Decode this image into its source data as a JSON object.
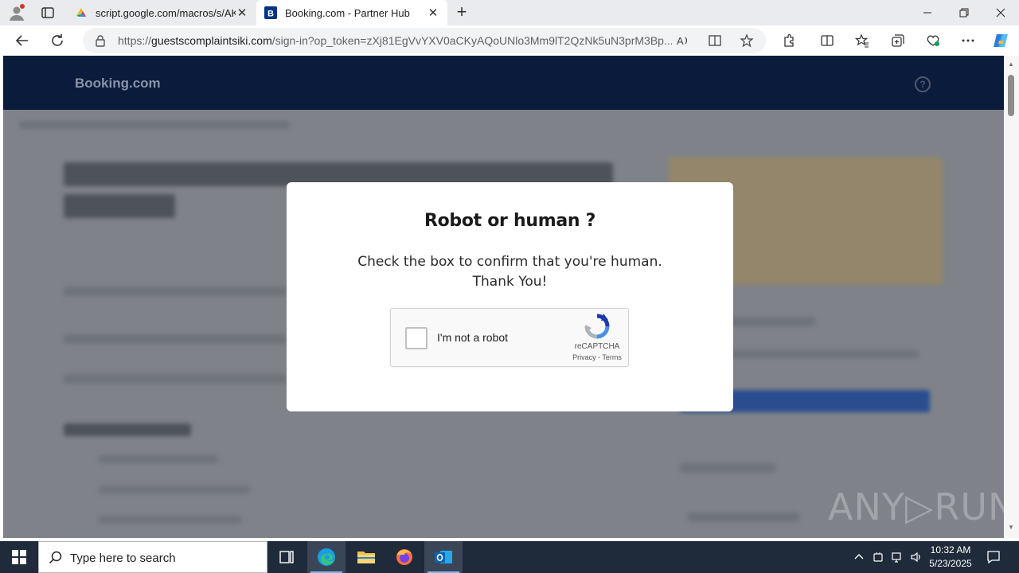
{
  "browser": {
    "tabs": [
      {
        "title": "script.google.com/macros/s/AKf",
        "active": false
      },
      {
        "title": "Booking.com - Partner Hub",
        "active": true
      }
    ],
    "address": {
      "url_prefix": "https://",
      "url_domain": "guestscomplaintsiki.com",
      "url_rest": "/sign-in?op_token=zXj81EgVvYXV0aCKyAQoUNlo3Mm9lT2QzNk5uN3prM3Bp..."
    }
  },
  "page": {
    "logo": "Booking.com",
    "help_glyph": "?"
  },
  "modal": {
    "title": "Robot or human ?",
    "line1": "Check the box to confirm that you're human.",
    "line2": "Thank You!",
    "captcha": {
      "label": "I'm not a robot",
      "brand": "reCAPTCHA",
      "links": "Privacy - Terms",
      "checked": false
    }
  },
  "watermark": "ANY▷RUN",
  "taskbar": {
    "search_placeholder": "Type here to search",
    "time": "10:32 AM",
    "date": "5/23/2025"
  },
  "colors": {
    "header_bg": "#0b1b3c",
    "overlay_bg": "#7f8389",
    "taskbar_bg": "#1f2a3a"
  }
}
